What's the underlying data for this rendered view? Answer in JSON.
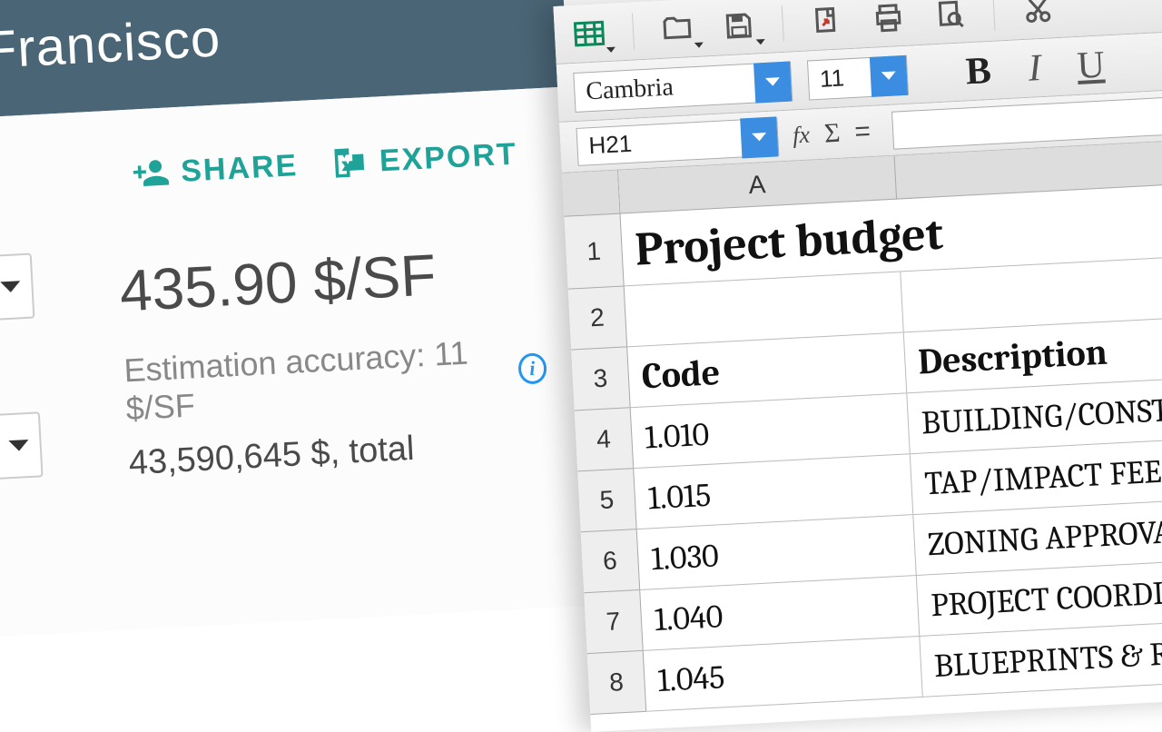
{
  "left": {
    "title": "Francisco",
    "actions": {
      "share": "SHARE",
      "export": "EXPORT"
    },
    "price": "435.90 $/SF",
    "accuracy": "Estimation accuracy: 11 $/SF",
    "total": "43,590,645 $, total"
  },
  "spreadsheet": {
    "font_name": "Cambria",
    "font_size": "11",
    "cell_ref": "H21",
    "columns": [
      "A"
    ],
    "title_cell": "Project budget",
    "header_row": {
      "code": "Code",
      "description": "Description"
    },
    "rows": [
      {
        "code": "1.010",
        "description": "BUILDING/CONSTR"
      },
      {
        "code": "1.015",
        "description": "TAP/IMPACT FEES"
      },
      {
        "code": "1.030",
        "description": "ZONING APPROVAL"
      },
      {
        "code": "1.040",
        "description": "PROJECT COORDINA"
      },
      {
        "code": "1.045",
        "description": "BLUEPRINTS & REP"
      }
    ],
    "toolbar_icons": [
      "grid",
      "folder",
      "save",
      "export-doc",
      "print",
      "preview",
      "cut"
    ],
    "format_buttons": {
      "bold": "B",
      "italic": "I",
      "underline": "U"
    },
    "fx_label": "fx",
    "sigma": "Σ",
    "eq": "="
  }
}
